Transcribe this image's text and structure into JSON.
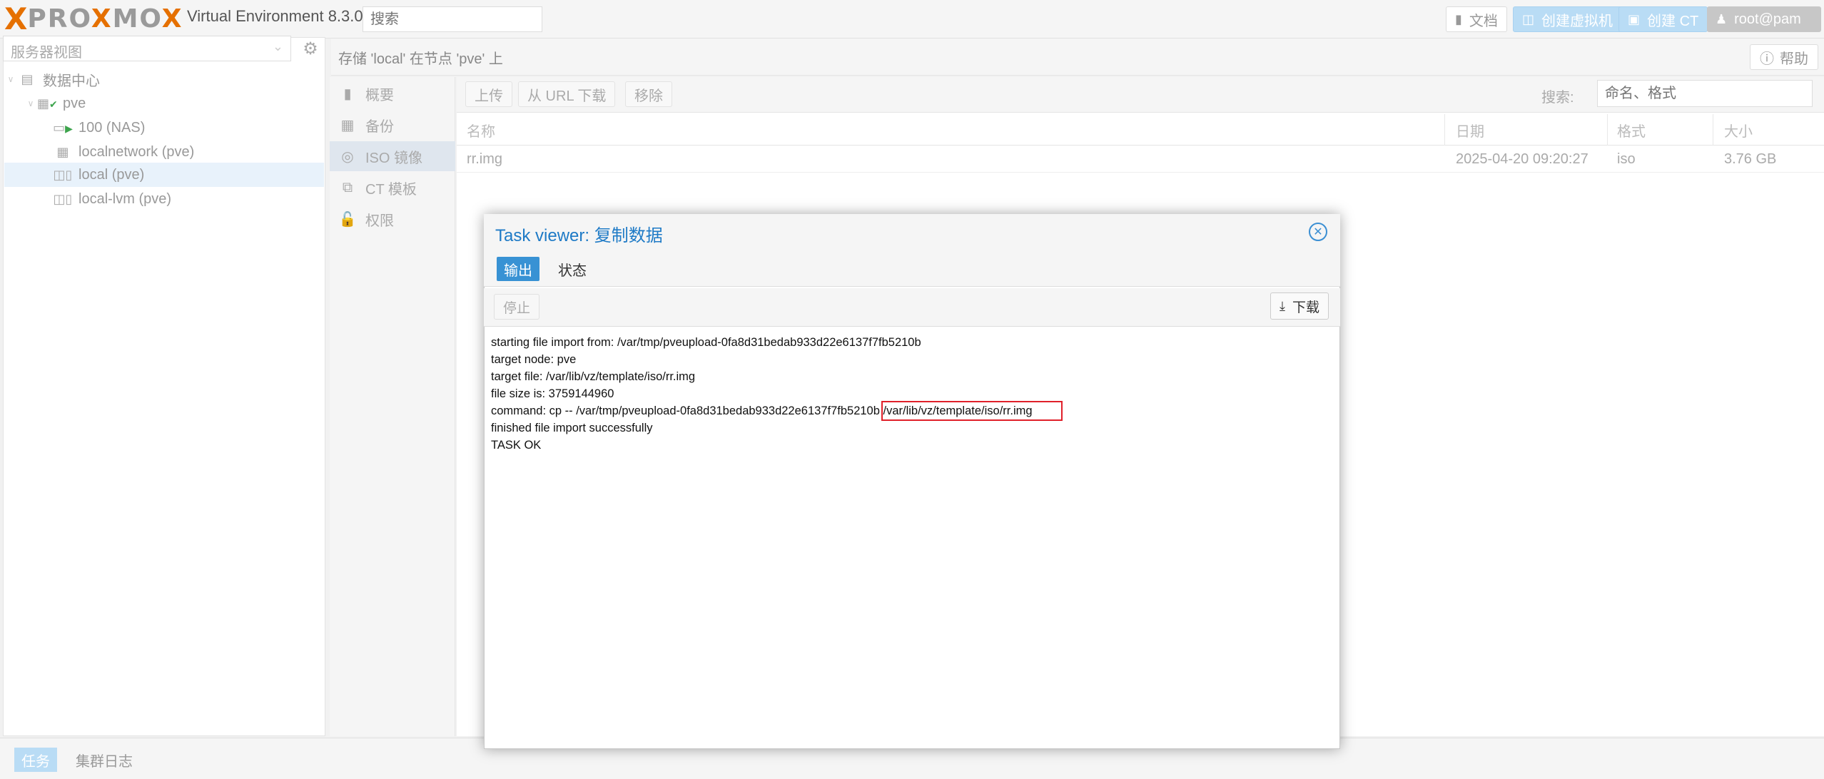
{
  "topbar": {
    "logo_text_x": "X",
    "logo_text_pro": "PRO",
    "logo_text_x2": "X",
    "logo_text_mo": "MO",
    "logo_text_x3": "X",
    "product": "Virtual Environment 8.3.0",
    "search_placeholder": "搜索",
    "docs_label": "文档",
    "create_vm_label": "创建虚拟机",
    "create_ct_label": "创建 CT",
    "user_label": "root@pam"
  },
  "tree": {
    "view_label": "服务器视图",
    "items": [
      {
        "label": "数据中心",
        "icon": "datacenter-icon"
      },
      {
        "label": "pve",
        "icon": "node-icon"
      },
      {
        "label": "100 (NAS)",
        "icon": "vm-icon"
      },
      {
        "label": "localnetwork (pve)",
        "icon": "network-icon"
      },
      {
        "label": "local (pve)",
        "icon": "storage-icon"
      },
      {
        "label": "local-lvm (pve)",
        "icon": "storage-icon"
      }
    ]
  },
  "content": {
    "title": "存储 'local' 在节点 'pve' 上",
    "help_label": "帮助"
  },
  "menu": {
    "items": [
      {
        "label": "概要",
        "icon": "book-icon"
      },
      {
        "label": "备份",
        "icon": "floppy-icon"
      },
      {
        "label": "ISO 镜像",
        "icon": "disc-icon"
      },
      {
        "label": "CT 模板",
        "icon": "template-icon"
      },
      {
        "label": "权限",
        "icon": "unlock-icon"
      }
    ]
  },
  "grid": {
    "upload_label": "上传",
    "download_url_label": "从 URL 下载",
    "remove_label": "移除",
    "search_label": "搜索:",
    "search_placeholder": "命名、格式",
    "columns": [
      "名称",
      "日期",
      "格式",
      "大小"
    ],
    "rows": [
      {
        "name": "rr.img",
        "date": "2025-04-20 09:20:27",
        "format": "iso",
        "size": "3.76 GB"
      }
    ]
  },
  "bottom": {
    "tasks_label": "任务",
    "cluster_log_label": "集群日志"
  },
  "dialog": {
    "title_prefix": "Task viewer: ",
    "title": "复制数据",
    "tab_output": "输出",
    "tab_status": "状态",
    "stop_label": "停止",
    "download_label": "下载",
    "log": [
      "starting file import from: /var/tmp/pveupload-0fa8d31bedab933d22e6137f7fb5210b",
      "target node: pve",
      "target file: /var/lib/vz/template/iso/rr.img",
      "file size is: 3759144960",
      "command: cp -- /var/tmp/pveupload-0fa8d31bedab933d22e6137f7fb5210b /var/lib/vz/template/iso/rr.img",
      "finished file import successfully",
      "TASK OK"
    ]
  },
  "colors": {
    "accent": "#3892d4",
    "brand_orange": "#e57000",
    "highlight_box": "#e0202a"
  }
}
